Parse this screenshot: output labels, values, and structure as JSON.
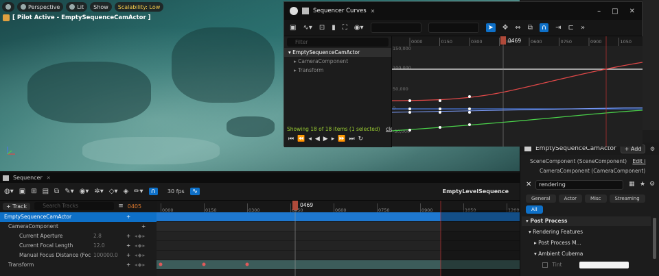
{
  "viewport": {
    "perspective_label": "Perspective",
    "lit_label": "Lit",
    "show_label": "Show",
    "scalability_label": "Scalability: Low",
    "pilot_label": "[ Pilot Active - EmptySequenceCamActor ]"
  },
  "curves": {
    "title": "Sequencer Curves",
    "filter_placeholder": "Filter",
    "tree": [
      {
        "label": "EmptySequenceCamActor"
      },
      {
        "label": "CameraComponent"
      },
      {
        "label": "Transform"
      }
    ],
    "status": "Showing 18 of 18 items (1 selected)",
    "clear_label": "clear",
    "playhead_frame": "0469",
    "ruler_ticks": [
      "0000",
      "0150",
      "0300",
      "0450",
      "0600",
      "0750",
      "0900",
      "1050"
    ],
    "y_labels": [
      "150,000",
      "100,000",
      "50,000",
      "0",
      "-50,000"
    ],
    "colors": {
      "red": "#e04848",
      "green": "#4ad04a",
      "blue": "#4a7ae0",
      "white": "#eeeeee"
    }
  },
  "details": {
    "actor_name": "EmptySequenceCamActor",
    "add_label": "+ Add",
    "scene_component": "SceneComponent (SceneComponent)",
    "edit_label": "Edit i",
    "camera_component": "CameraComponent (CameraComponent)",
    "search_value": "rendering",
    "tabs": [
      "General",
      "Actor",
      "Misc",
      "Streaming",
      "All"
    ],
    "post_process": "Post Process",
    "rendering_features": "Rendering Features",
    "post_process_m": "Post Process M...",
    "ambient_cubemap": "Ambient Cubema",
    "tint_label": "Tint"
  },
  "sequencer": {
    "tab_label": "Sequencer",
    "fps_label": "30 fps",
    "sequence_name": "EmptyLevelSequence",
    "track_label": "+ Track",
    "search_placeholder": "Search Tracks",
    "current_frame": "0469",
    "start_frame": "0405",
    "ruler_ticks": [
      "0000",
      "0150",
      "0300",
      "0450",
      "0600",
      "0750",
      "0900",
      "1050",
      "1200"
    ],
    "rows": [
      {
        "label": "EmptySequenceCamActor",
        "value": ""
      },
      {
        "label": "CameraComponent",
        "value": ""
      },
      {
        "label": "Current Aperture",
        "value": "2.8"
      },
      {
        "label": "Current Focal Length",
        "value": "12.0"
      },
      {
        "label": "Manual Focus Distance (Focus S",
        "value": "100000.0"
      },
      {
        "label": "Transform",
        "value": ""
      }
    ]
  }
}
